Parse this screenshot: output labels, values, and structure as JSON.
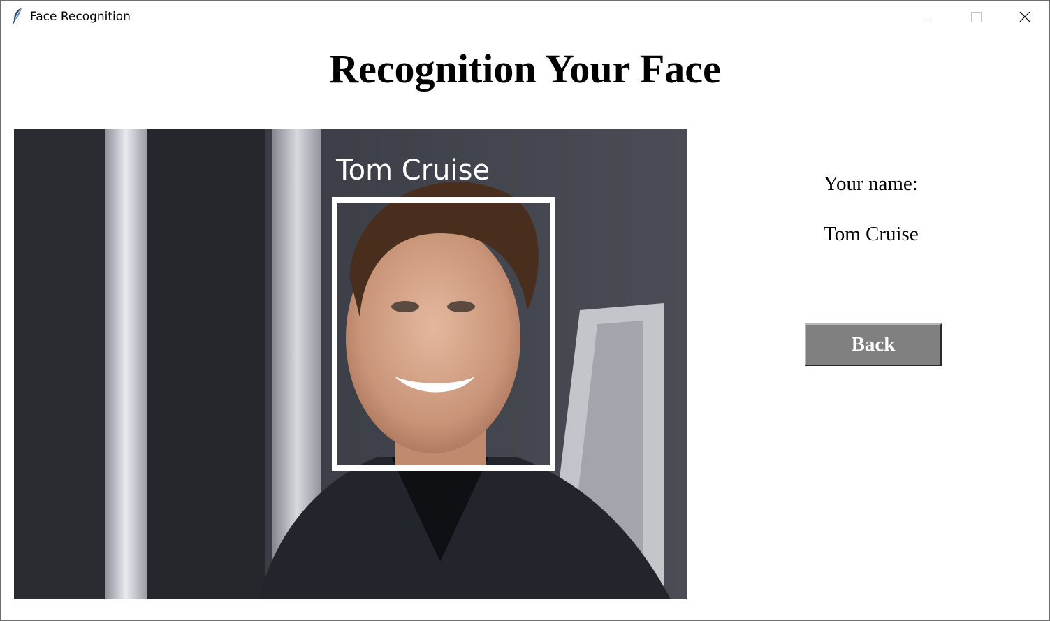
{
  "window": {
    "title": "Face Recognition",
    "icon": "feather-icon",
    "controls": [
      "minimize-icon",
      "maximize-icon",
      "close-icon"
    ]
  },
  "main": {
    "heading": "Recognition Your Face"
  },
  "photo": {
    "detected_name": "Tom Cruise"
  },
  "result": {
    "name_label": "Your name:",
    "name_value": "Tom Cruise"
  },
  "actions": {
    "back_label": "Back"
  },
  "colors": {
    "button_bg": "#808080",
    "button_text": "#ffffff",
    "face_box": "#ffffff"
  }
}
